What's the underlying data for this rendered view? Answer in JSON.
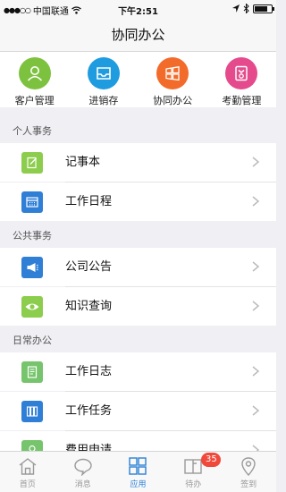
{
  "status_bar": {
    "signal": "●●●○○",
    "carrier": "中国联通",
    "time": "下午2:51"
  },
  "nav": {
    "title": "协同办公"
  },
  "quick_actions": [
    {
      "label": "客户管理",
      "icon": "customer-icon",
      "color": "#7dc23f"
    },
    {
      "label": "进销存",
      "icon": "inventory-tray-icon",
      "color": "#1f9be0"
    },
    {
      "label": "协同办公",
      "icon": "windows-icon",
      "color": "#f36b2a"
    },
    {
      "label": "考勤管理",
      "icon": "attendance-icon",
      "color": "#e44a8c"
    }
  ],
  "sections": [
    {
      "title": "个人事务",
      "items": [
        {
          "label": "记事本",
          "icon": "notepad-icon",
          "color": "#8ccd4d"
        },
        {
          "label": "工作日程",
          "icon": "calendar-icon",
          "color": "#2f7fd7"
        }
      ]
    },
    {
      "title": "公共事务",
      "items": [
        {
          "label": "公司公告",
          "icon": "megaphone-icon",
          "color": "#2f7fd7"
        },
        {
          "label": "知识查询",
          "icon": "eye-icon",
          "color": "#8ccd4d"
        }
      ]
    },
    {
      "title": "日常办公",
      "items": [
        {
          "label": "工作日志",
          "icon": "log-document-icon",
          "color": "#76c46c"
        },
        {
          "label": "工作任务",
          "icon": "task-binders-icon",
          "color": "#2f7fd7"
        },
        {
          "label": "费用申请",
          "icon": "expense-icon",
          "color": "#76c46c"
        }
      ]
    }
  ],
  "tab_bar": {
    "tabs": [
      {
        "label": "首页",
        "icon": "home-icon"
      },
      {
        "label": "消息",
        "icon": "message-icon"
      },
      {
        "label": "应用",
        "icon": "apps-grid-icon",
        "active": true
      },
      {
        "label": "待办",
        "icon": "todo-icon",
        "badge": "35"
      },
      {
        "label": "签到",
        "icon": "location-pin-icon"
      }
    ]
  }
}
